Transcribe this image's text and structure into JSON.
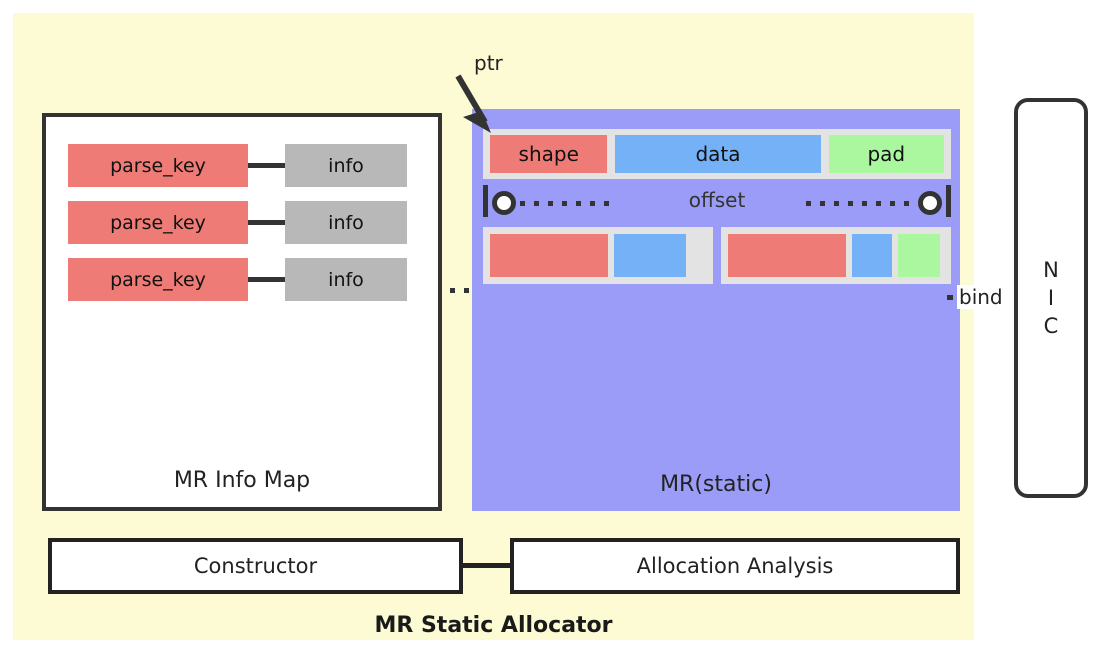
{
  "diagram": {
    "title": "MR Static Allocator",
    "background_color": "#fdfbd4"
  },
  "mr_info_map": {
    "label": "MR Info Map",
    "rows": [
      {
        "key": "parse_key",
        "info": "info"
      },
      {
        "key": "parse_key",
        "info": "info"
      },
      {
        "key": "parse_key",
        "info": "info"
      }
    ]
  },
  "mr_static": {
    "label": "MR(static)",
    "pointer_label": "ptr",
    "offset_label": "offset",
    "top_segments": [
      {
        "name": "shape",
        "label": "shape",
        "color": "#ee7b76"
      },
      {
        "name": "data",
        "label": "data",
        "color": "#74b1f7"
      },
      {
        "name": "pad",
        "label": "pad",
        "color": "#abf7a0"
      }
    ],
    "block_1_segments": [
      {
        "name": "shape",
        "label": "",
        "color": "#ee7b76"
      },
      {
        "name": "data",
        "label": "",
        "color": "#74b1f7"
      }
    ],
    "block_2_segments": [
      {
        "name": "shape",
        "label": "",
        "color": "#ee7b76"
      },
      {
        "name": "data",
        "label": "",
        "color": "#74b1f7"
      },
      {
        "name": "pad",
        "label": "",
        "color": "#abf7a0"
      }
    ]
  },
  "bind": {
    "label": "bind"
  },
  "nic": {
    "letters": [
      "N",
      "I",
      "C"
    ]
  },
  "bottom": {
    "constructor_label": "Constructor",
    "allocation_analysis_label": "Allocation Analysis"
  },
  "colors": {
    "panel_yellow": "#fdfbd4",
    "mr_purple": "#9a9cf7",
    "shape_red": "#ee7b76",
    "data_blue": "#74b1f7",
    "pad_green": "#abf7a0",
    "info_gray": "#b8b8b8",
    "slot_gray": "#e3e3e3",
    "outline": "#333333"
  }
}
